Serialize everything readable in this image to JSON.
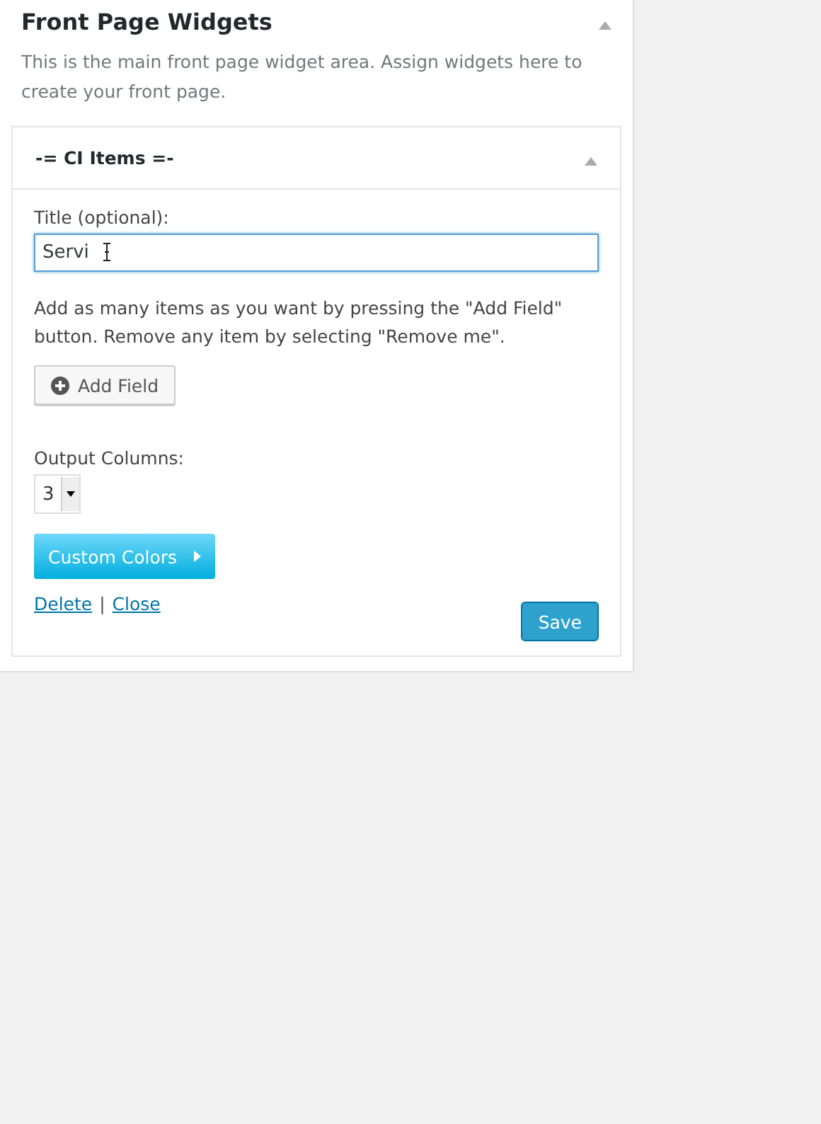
{
  "sidebar": {
    "title": "Front Page Widgets",
    "expanded": true,
    "description": "This is the main front page widget area. Assign widgets here to create your front page."
  },
  "widget": {
    "title": "-= CI Items =-",
    "expanded": true,
    "title_field": {
      "label": "Title (optional):",
      "value": "Servi",
      "focused": true
    },
    "help": "Add as many items as you want by pressing the \"Add Field\" button. Remove any item by selecting \"Remove me\".",
    "add_button": "Add Field",
    "columns": {
      "label": "Output Columns:",
      "value": "3"
    },
    "colors_button": "Custom Colors",
    "links": [
      "Delete",
      "Close"
    ],
    "separator": "|",
    "save_button": "Save"
  }
}
